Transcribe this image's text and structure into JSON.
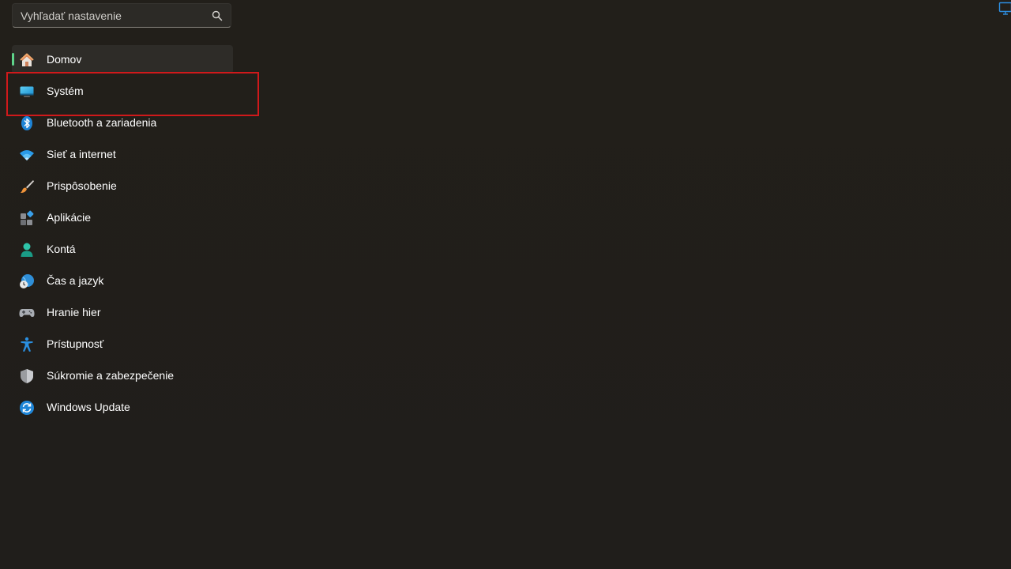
{
  "search": {
    "placeholder": "Vyhľadať nastavenie",
    "value": "",
    "icon": "search-icon"
  },
  "nav": {
    "active_index": 0,
    "highlighted_index": 1,
    "accent_color": "#5fd38a",
    "highlight_color": "#d0191b",
    "items": [
      {
        "label": "Domov",
        "icon": "home-icon"
      },
      {
        "label": "Systém",
        "icon": "system-display-icon"
      },
      {
        "label": "Bluetooth a zariadenia",
        "icon": "bluetooth-icon"
      },
      {
        "label": "Sieť a internet",
        "icon": "wifi-icon"
      },
      {
        "label": "Prispôsobenie",
        "icon": "paintbrush-icon"
      },
      {
        "label": "Aplikácie",
        "icon": "apps-icon"
      },
      {
        "label": "Kontá",
        "icon": "account-icon"
      },
      {
        "label": "Čas a jazyk",
        "icon": "time-language-icon"
      },
      {
        "label": "Hranie hier",
        "icon": "gamepad-icon"
      },
      {
        "label": "Prístupnosť",
        "icon": "accessibility-icon"
      },
      {
        "label": "Súkromie a zabezpečenie",
        "icon": "shield-icon"
      },
      {
        "label": "Windows Update",
        "icon": "update-icon"
      }
    ]
  },
  "corner": {
    "icon": "display-icon"
  }
}
